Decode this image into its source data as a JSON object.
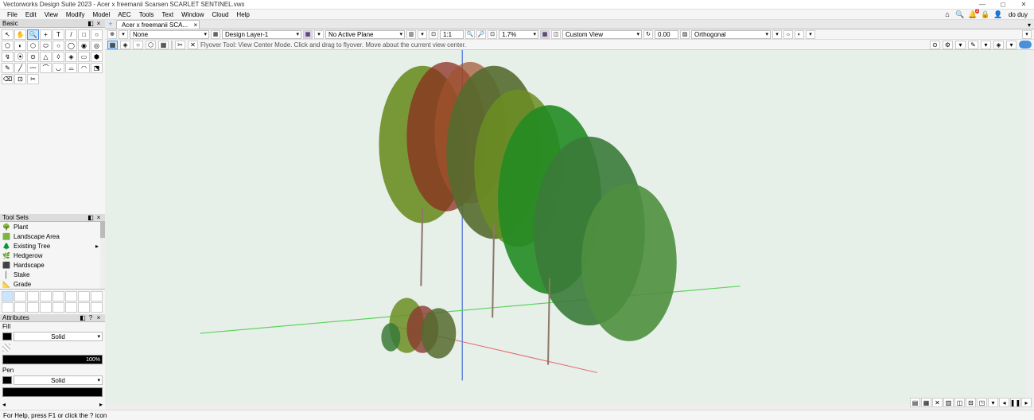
{
  "window": {
    "title": "Vectorworks Design Suite 2023 - Acer x freemanii Scarsen SCARLET SENTINEL.vwx",
    "min": "—",
    "max": "◻",
    "close": "✕"
  },
  "menu": [
    "File",
    "Edit",
    "View",
    "Modify",
    "Model",
    "AEC",
    "Tools",
    "Text",
    "Window",
    "Cloud",
    "Help"
  ],
  "user": "do duy",
  "notif_badge": "1",
  "panels": {
    "basic": "Basic",
    "toolsets": "Tool Sets",
    "attributes": "Attributes",
    "fill": "Fill",
    "pen": "Pen"
  },
  "basic_tools": [
    "↖",
    "✋",
    "🔍",
    "+",
    "T",
    "/",
    "□",
    "○",
    "⬠",
    "◐",
    "⬡",
    "⬭",
    "○",
    "◯",
    "◉",
    "◎",
    "↯",
    "⦿",
    "⊙",
    "△",
    "◊",
    "◈",
    "▭",
    "⬢",
    "✎",
    "╱",
    "〰",
    "⌒",
    "◡",
    "⌓",
    "◠",
    "⬔",
    "⌫",
    "⊡",
    "✂"
  ],
  "toolsets": {
    "items": [
      {
        "icon": "🌳",
        "label": "Plant"
      },
      {
        "icon": "🟩",
        "label": "Landscape Area"
      },
      {
        "icon": "🌲",
        "label": "Existing Tree"
      },
      {
        "icon": "🌿",
        "label": "Hedgerow"
      },
      {
        "icon": "⬛",
        "label": "Hardscape"
      },
      {
        "icon": "│",
        "label": "Stake"
      },
      {
        "icon": "📐",
        "label": "Grade"
      }
    ],
    "sub_count": 16
  },
  "attributes": {
    "fill_mode": "Solid",
    "opacity": "100%",
    "pen_mode": "Solid"
  },
  "tab": {
    "add": "+",
    "name": "Acer x freemanii SCA...",
    "close": "×"
  },
  "viewbar": {
    "class": "None",
    "layer": "Design Layer-1",
    "plane": "No Active Plane",
    "scale": "1:1",
    "zoom": "1.7%",
    "view": "Custom View",
    "rot": "0.00",
    "rot2": "0.00°",
    "proj": "Orthogonal"
  },
  "modebar": {
    "hint": "Flyover Tool: View Center Mode. Click and drag to flyover.  Move about the current view center."
  },
  "status": "For Help, press F1 or click the ? icon"
}
